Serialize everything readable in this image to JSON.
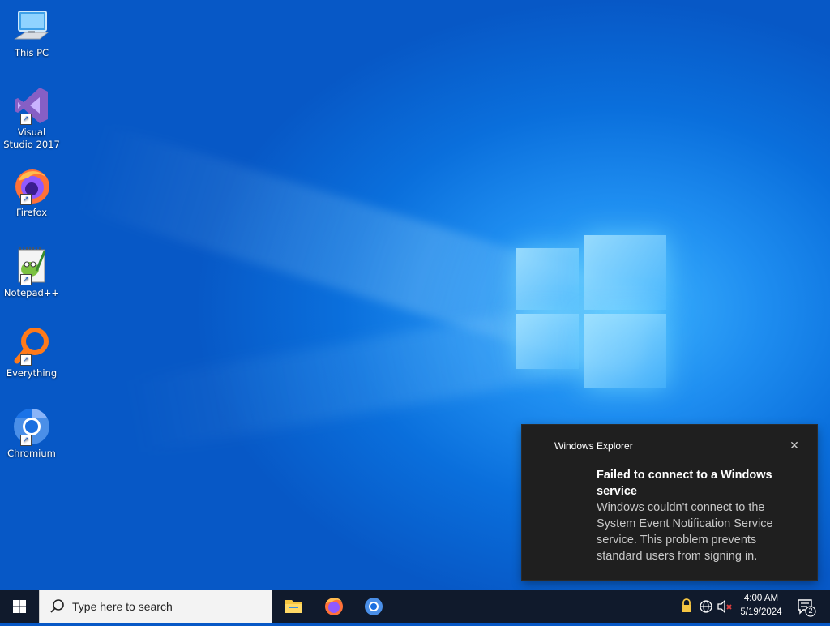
{
  "desktop_icons": [
    {
      "label": "This PC",
      "icon": "this-pc-icon"
    },
    {
      "label": "Visual Studio 2017",
      "icon": "visual-studio-icon"
    },
    {
      "label": "Firefox",
      "icon": "firefox-icon"
    },
    {
      "label": "Notepad++",
      "icon": "notepadpp-icon"
    },
    {
      "label": "Everything",
      "icon": "everything-icon"
    },
    {
      "label": "Chromium",
      "icon": "chromium-icon"
    }
  ],
  "notification": {
    "app_name": "Windows Explorer",
    "title": "Failed to connect to a Windows service",
    "body": "Windows couldn't connect to the System Event Notification Service service. This problem prevents standard users from signing in.",
    "close_icon": "close-icon"
  },
  "taskbar": {
    "search_placeholder": "Type here to search",
    "pinned": [
      "file-explorer-icon",
      "firefox-icon",
      "chromium-icon"
    ],
    "tray_icons": [
      "lock-icon",
      "network-icon",
      "volume-muted-icon"
    ],
    "time": "4:00 AM",
    "date": "5/19/2024",
    "notification_count": "2"
  },
  "colors": {
    "toast_bg": "#1f1f1f",
    "taskbar_bg": "#101a2c",
    "desktop_blue": "#0a6fdc"
  }
}
